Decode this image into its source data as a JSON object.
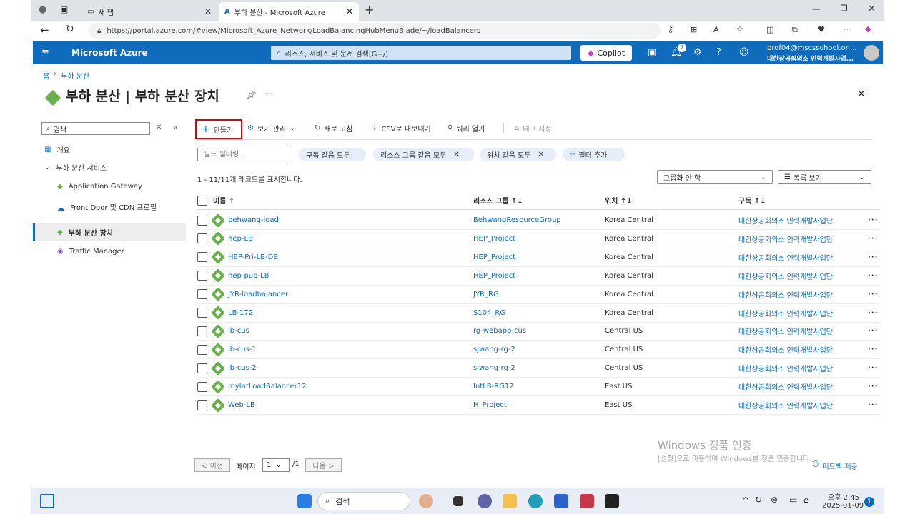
{
  "browser": {
    "tab_inactive_label": "새 탭",
    "tab_active_label": "부하 분산 - Microsoft Azure",
    "url": "https://portal.azure.com/#view/Microsoft_Azure_Network/LoadBalancingHubMenuBlade/~/loadBalancers"
  },
  "azure_header": {
    "brand": "Microsoft Azure",
    "search_placeholder": "리소스, 서비스 및 문서 검색(G+/)",
    "copilot_label": "Copilot",
    "notification_count": "7",
    "user_email": "prof04@mscsschool.on...",
    "user_org": "대한상공회의소 인력개발사업..."
  },
  "breadcrumb": {
    "home": "홈",
    "current": "부하 분산"
  },
  "page": {
    "title": "부하 분산 | 부하 분산 장치"
  },
  "leftnav": {
    "search_placeholder": "검색",
    "overview": "개요",
    "group_label": "부하 분산 서비스",
    "items": [
      "Application Gateway",
      "Front Door 및 CDN 프로필",
      "부하 분산 장치",
      "Traffic Manager"
    ]
  },
  "toolbar": {
    "create": "만들기",
    "manage_view": "보기 관리",
    "refresh": "새로 고침",
    "export_csv": "CSV로 내보내기",
    "open_query": "쿼리 열기",
    "assign_tags": "태그 지정"
  },
  "filters": {
    "field_filter_placeholder": "필드 필터링...",
    "pills": [
      "구독 같음 모두",
      "리소스 그룹 같음 모두",
      "위치 같음 모두",
      "필터 추가"
    ]
  },
  "records_text": "1 - 11/11개 레코드를 표시합니다.",
  "grouping_select": "그룹화 안 함",
  "view_select": "목록 보기",
  "table": {
    "headers": [
      "이름",
      "리소스 그룹",
      "위치",
      "구독"
    ],
    "rows": [
      [
        "behwang-load",
        "BehwangResourceGroup",
        "Korea Central",
        "대한상공회의소 인력개발사업단"
      ],
      [
        "hep-LB",
        "HEP_Project",
        "Korea Central",
        "대한상공회의소 인력개발사업단"
      ],
      [
        "HEP-Pri-LB-DB",
        "HEP_Project",
        "Korea Central",
        "대한상공회의소 인력개발사업단"
      ],
      [
        "hep-pub-LB",
        "HEP_Project",
        "Korea Central",
        "대한상공회의소 인력개발사업단"
      ],
      [
        "JYR-loadbalancer",
        "JYR_RG",
        "Korea Central",
        "대한상공회의소 인력개발사업단"
      ],
      [
        "LB-172",
        "S104_RG",
        "Korea Central",
        "대한상공회의소 인력개발사업단"
      ],
      [
        "lb-cus",
        "rg-webapp-cus",
        "Central US",
        "대한상공회의소 인력개발사업단"
      ],
      [
        "lb-cus-1",
        "sjwang-rg-2",
        "Central US",
        "대한상공회의소 인력개발사업단"
      ],
      [
        "lb-cus-2",
        "sjwang-rg-2",
        "Central US",
        "대한상공회의소 인력개발사업단"
      ],
      [
        "myIntLoadBalancer12",
        "IntLB-RG12",
        "East US",
        "대한상공회의소 인력개발사업단"
      ],
      [
        "Web-LB",
        "H_Project",
        "East US",
        "대한상공회의소 인력개발사업단"
      ]
    ]
  },
  "pagination": {
    "prev": "< 이전",
    "page_label": "페이지",
    "page_value": "1",
    "page_total": "/1",
    "next": "다음 >"
  },
  "watermark": {
    "line1": "Windows 정품 인증",
    "line2": "[설정]으로 이동하여 Windows를 정품 인증합니다."
  },
  "feedback": "피드백 제공",
  "taskbar": {
    "search_placeholder": "검색",
    "time": "오후 2:45",
    "date": "2025-01-09",
    "badge": "1"
  }
}
